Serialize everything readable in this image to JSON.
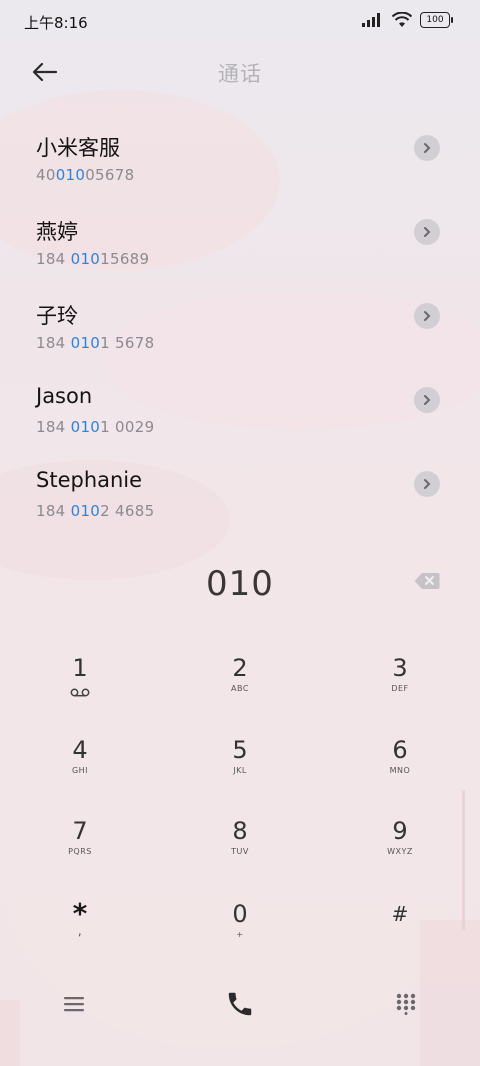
{
  "status": {
    "time": "上午8:16",
    "battery": "100"
  },
  "header": {
    "title": "通话"
  },
  "contacts": [
    {
      "name": "小米客服",
      "number_pre": "40",
      "number_match": "010",
      "number_post": "05678"
    },
    {
      "name": "燕婷",
      "number_pre": "184 ",
      "number_match": "010",
      "number_post": "15689"
    },
    {
      "name": "子玲",
      "number_pre": "184 ",
      "number_match": "010",
      "number_post": "1 5678"
    },
    {
      "name": "Jason",
      "number_pre": "184 ",
      "number_match": "010",
      "number_post": "1 0029"
    },
    {
      "name": "Stephanie",
      "number_pre": "184 ",
      "number_match": "010",
      "number_post": "2 4685"
    }
  ],
  "dialer": {
    "input": "010"
  },
  "keypad": [
    {
      "digit": "1",
      "letters": ""
    },
    {
      "digit": "2",
      "letters": "ABC"
    },
    {
      "digit": "3",
      "letters": "DEF"
    },
    {
      "digit": "4",
      "letters": "GHI"
    },
    {
      "digit": "5",
      "letters": "JKL"
    },
    {
      "digit": "6",
      "letters": "MNO"
    },
    {
      "digit": "7",
      "letters": "PQRS"
    },
    {
      "digit": "8",
      "letters": "TUV"
    },
    {
      "digit": "9",
      "letters": "WXYZ"
    },
    {
      "digit": "*",
      "letters": ","
    },
    {
      "digit": "0",
      "letters": "+"
    },
    {
      "digit": "#",
      "letters": ""
    }
  ],
  "colors": {
    "highlight": "#2d83db",
    "title": "#b5b3b8",
    "call_icon": "#2b2b2b"
  },
  "icons": {
    "back": "arrow-left-icon",
    "detail": "chevron-right-icon",
    "backspace": "backspace-icon",
    "voicemail": "voicemail-icon",
    "menu": "menu-icon",
    "call": "phone-icon",
    "keypad": "dialpad-icon"
  }
}
